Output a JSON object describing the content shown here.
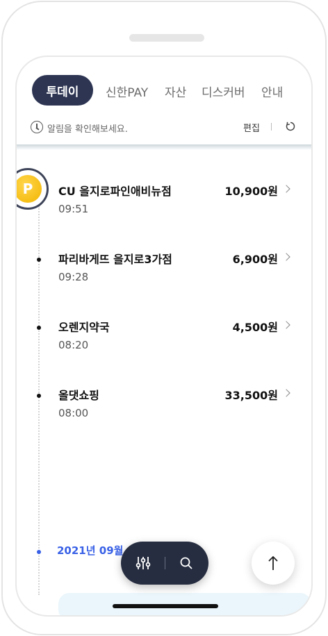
{
  "tabs": {
    "active": "투데이",
    "items": [
      "신한PAY",
      "자산",
      "디스커버",
      "안내"
    ]
  },
  "notice": {
    "text": "알림을 확인해보세요.",
    "edit_label": "편집"
  },
  "badge": {
    "letter": "P"
  },
  "transactions": [
    {
      "merchant": "CU 을지로파인애비뉴점",
      "time": "09:51",
      "amount": "10,900원"
    },
    {
      "merchant": "파리바게뜨 을지로3가점",
      "time": "09:28",
      "amount": "6,900원"
    },
    {
      "merchant": "오렌지약국",
      "time": "08:20",
      "amount": "4,500원"
    },
    {
      "merchant": "올댓쇼핑",
      "time": "08:00",
      "amount": "33,500원"
    }
  ],
  "date_group": {
    "label": "2021년 09월 0"
  },
  "colors": {
    "active_tab_bg": "#2d3553",
    "accent_blue": "#3860e6",
    "badge_yellow": "#f2b500",
    "float_bar_bg": "#262d40"
  },
  "icons": {
    "clock": "clock-icon",
    "refresh": "refresh-icon",
    "chevron": "chevron-right-icon",
    "filter": "filter-sliders-icon",
    "search": "search-icon",
    "top": "arrow-up-icon"
  }
}
